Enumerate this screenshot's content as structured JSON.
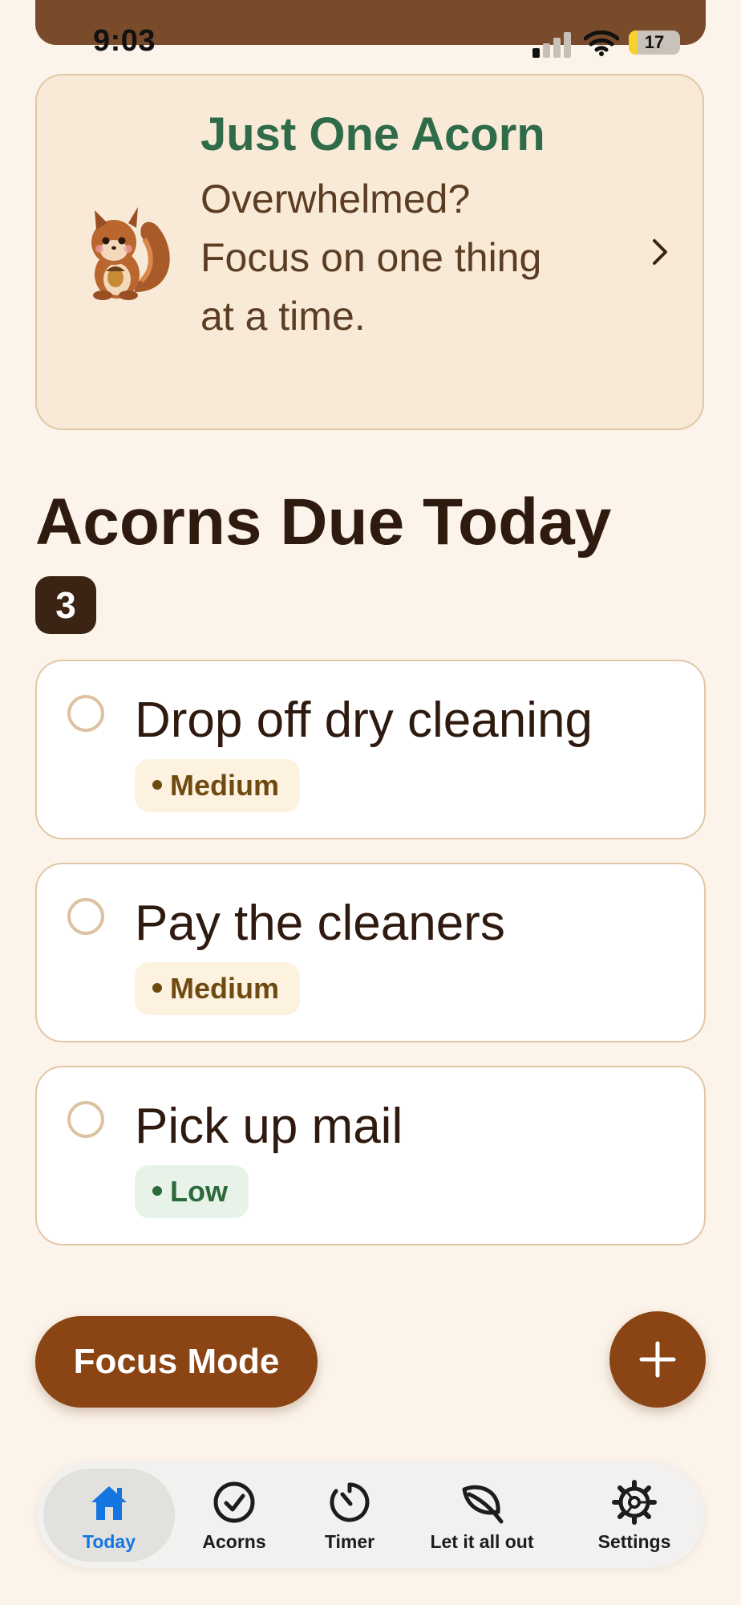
{
  "status_bar": {
    "time": "9:03",
    "battery": "17",
    "battery_level": 0.17
  },
  "promo": {
    "title": "Just One Acorn",
    "subtitle": "Overwhelmed? Focus on one thing at a time."
  },
  "section": {
    "title": "Acorns Due Today",
    "count": "3"
  },
  "tasks": [
    {
      "title": "Drop off dry cleaning",
      "priority": "Medium"
    },
    {
      "title": "Pay the cleaners",
      "priority": "Medium"
    },
    {
      "title": "Pick up mail",
      "priority": "Low"
    }
  ],
  "actions": {
    "focus_mode": "Focus Mode"
  },
  "tabs": [
    {
      "label": "Today",
      "icon": "home-icon",
      "active": true
    },
    {
      "label": "Acorns",
      "icon": "check-circle-icon"
    },
    {
      "label": "Timer",
      "icon": "timer-icon"
    },
    {
      "label": "Let it all out",
      "icon": "leaf-icon"
    },
    {
      "label": "Settings",
      "icon": "gear-icon"
    }
  ],
  "colors": {
    "background": "#fcf4ea",
    "accent_brown": "#8b4515",
    "promo_title_green": "#2f6b49",
    "active_tab_blue": "#1476e0"
  }
}
